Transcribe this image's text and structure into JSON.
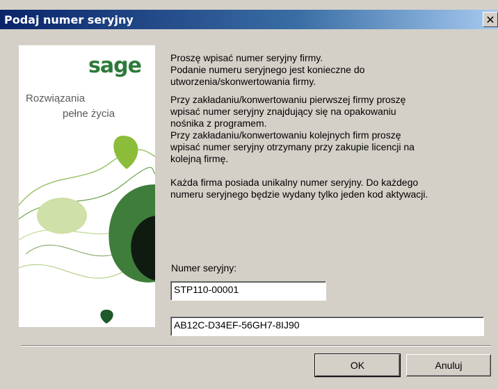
{
  "dialog": {
    "title": "Podaj numer seryjny",
    "close_symbol": "✕"
  },
  "banner": {
    "logo": "sage",
    "tagline_line1": "Rozwiązania",
    "tagline_line2": "pełne życia",
    "colors": {
      "brand_green": "#2d7a3a",
      "light_green": "#8cbd3a",
      "dark_green": "#1f5a2a"
    }
  },
  "info": {
    "para1": "Proszę wpisać numer seryjny firmy.\nPodanie numeru seryjnego jest konieczne do\nutworzenia/skonwertowania firmy.",
    "para2": "Przy zakładaniu/konwertowaniu pierwszej firmy proszę\nwpisać numer seryjny znajdujący się na opakowaniu\nnośnika z programem.\nPrzy zakładaniu/konwertowaniu kolejnych firm proszę\nwpisać numer seryjny otrzymany przy zakupie licencji na\nkolejną firmę.",
    "para3": "Każda firma posiada unikalny numer seryjny. Do każdego\nnumeru seryjnego będzie wydany tylko jeden kod aktywacji."
  },
  "form": {
    "serial_label": "Numer seryjny:",
    "serial_value": "STP110-00001",
    "code_value": "AB12C-D34EF-56GH7-8IJ90"
  },
  "buttons": {
    "ok": "OK",
    "cancel": "Anuluj"
  }
}
